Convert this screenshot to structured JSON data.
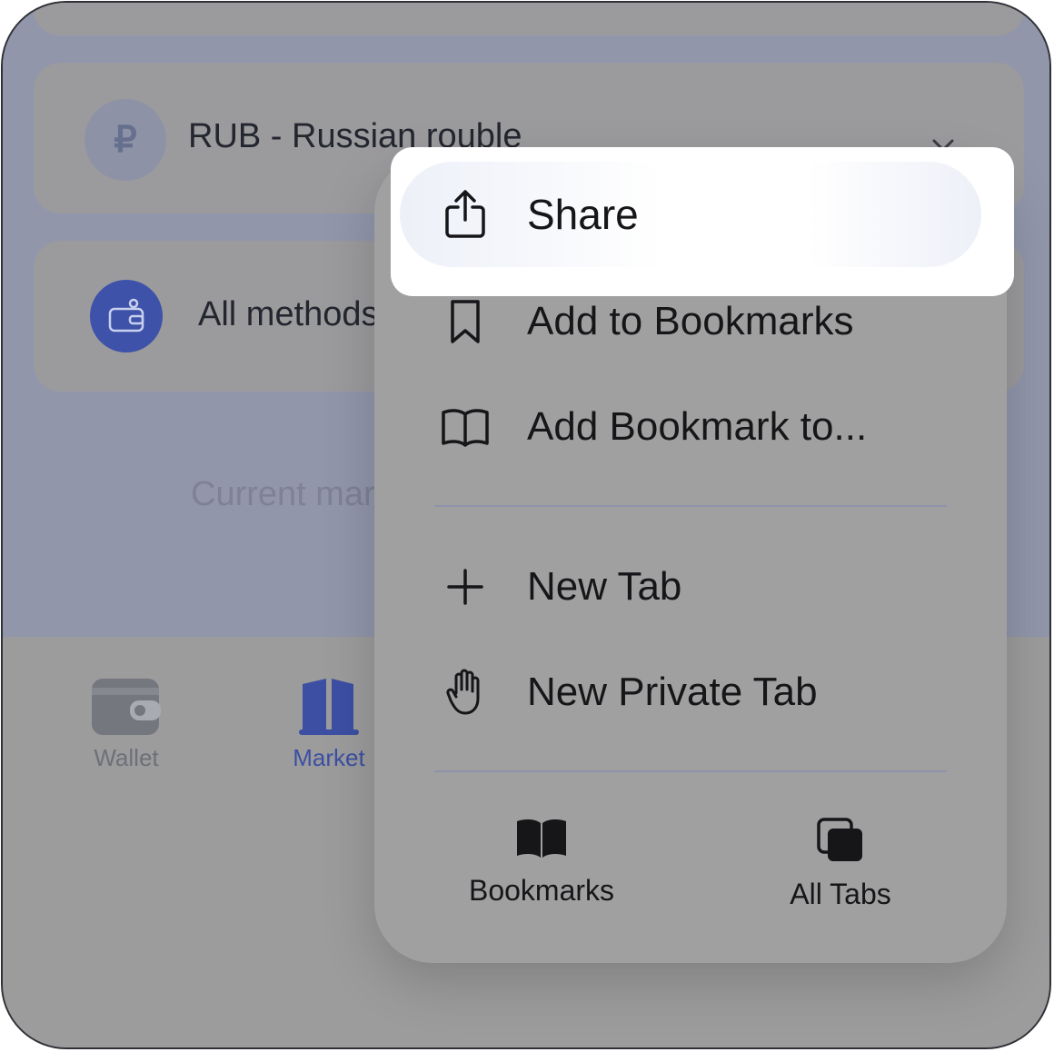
{
  "background_app": {
    "currency_icon": "₽",
    "currency_label": "RUB - Russian rouble",
    "methods_label": "All methods",
    "current_label": "Current market",
    "nav": [
      {
        "label": "Wallet",
        "icon": "wallet-icon"
      },
      {
        "label": "Market",
        "icon": "market-icon"
      }
    ]
  },
  "menu": {
    "share_label": "Share",
    "items": [
      {
        "label": "Add to Bookmarks",
        "icon": "bookmark-icon"
      },
      {
        "label": "Add Bookmark to...",
        "icon": "open-book-icon"
      },
      {
        "label": "New Tab",
        "icon": "plus-icon"
      },
      {
        "label": "New Private Tab",
        "icon": "hand-icon"
      }
    ],
    "bottom": [
      {
        "label": "Bookmarks",
        "icon": "book-filled-icon"
      },
      {
        "label": "All Tabs",
        "icon": "tabs-icon"
      }
    ]
  },
  "colors": {
    "accent": "#3d52a8",
    "overlay_top": "#9196ab",
    "overlay_bottom": "#9c9c9d",
    "menu_bg": "#a0a0a1"
  }
}
